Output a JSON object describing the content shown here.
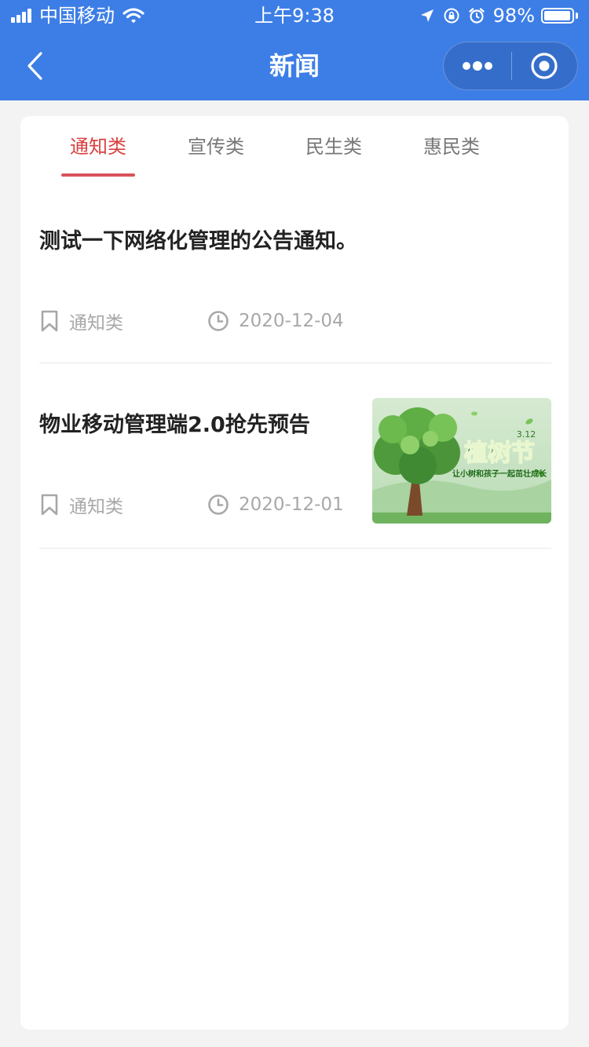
{
  "status_bar": {
    "carrier": "中国移动",
    "time": "上午9:38",
    "battery": "98%",
    "battery_level": 0.98
  },
  "nav": {
    "title": "新闻"
  },
  "tabs": [
    {
      "label": "通知类",
      "active": true
    },
    {
      "label": "宣传类",
      "active": false
    },
    {
      "label": "民生类",
      "active": false
    },
    {
      "label": "惠民类",
      "active": false
    }
  ],
  "news": [
    {
      "title": "测试一下网络化管理的公告通知。",
      "category": "通知类",
      "date": "2020-12-04",
      "has_image": false
    },
    {
      "title": "物业移动管理端2.0抢先预告",
      "category": "通知类",
      "date": "2020-12-01",
      "has_image": true,
      "image": {
        "title": "植树节",
        "date_mark": "3.12",
        "slogan": "让小树和孩子一起茁壮成长"
      }
    }
  ],
  "colors": {
    "header": "#3d7ee6",
    "active_tab": "#d9403f",
    "meta_text": "#a8a8a8"
  },
  "icons": {
    "back": "chevron-left-icon",
    "more": "more-dots-icon",
    "close": "target-circle-icon",
    "category": "bookmark-icon",
    "date": "clock-icon"
  }
}
